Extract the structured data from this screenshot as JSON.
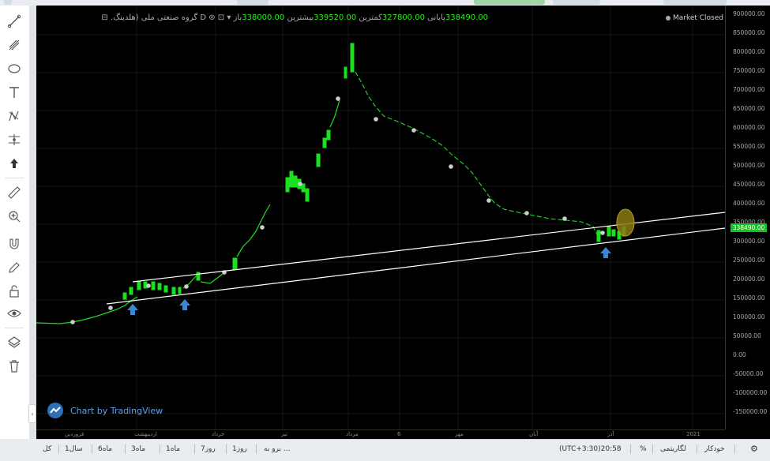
{
  "header": {
    "symbol": "گروه صنعتی ملی (هلدینگ.",
    "interval": "D",
    "open_label": "باز",
    "open_value": "338000.00",
    "high_label": "بیشترین",
    "high_value": "339520.00",
    "low_label": "کمترین",
    "low_value": "327800.00",
    "close_label": "پایانی",
    "close_value": "338490.00"
  },
  "status": {
    "market": "Market Closed"
  },
  "price_axis": {
    "ticks": [
      "900000.00",
      "850000.00",
      "800000.00",
      "750000.00",
      "700000.00",
      "650000.00",
      "600000.00",
      "550000.00",
      "500000.00",
      "450000.00",
      "400000.00",
      "350000.00",
      "300000.00",
      "250000.00",
      "200000.00",
      "150000.00",
      "100000.00",
      "50000.00",
      "0.00",
      "-50000.00",
      "-100000.00",
      "-150000.00"
    ],
    "last_price": "338490.00"
  },
  "time_axis": {
    "labels": [
      "فروردین",
      "اردیبهشت",
      "خرداد",
      "تیر",
      "مرداد",
      "6",
      "مهر",
      "آبان",
      "آذر",
      "2021"
    ]
  },
  "watermark": {
    "text": "Chart by TradingView"
  },
  "bottom_bar": {
    "ranges": [
      "کل",
      "1سال",
      "6ماه",
      "3ماه",
      "1ماه",
      "7روز",
      "1روز"
    ],
    "goto": "برو به ...",
    "time": "(UTC+3:30)20:58",
    "percent": "%",
    "log": "لگاریتمی",
    "auto": "خودکار"
  },
  "colors": {
    "candle": "#19e11d",
    "background": "#000000",
    "trendline": "#ffffff",
    "arrow": "#3e86d1",
    "highlight": "#8a7a14"
  }
}
